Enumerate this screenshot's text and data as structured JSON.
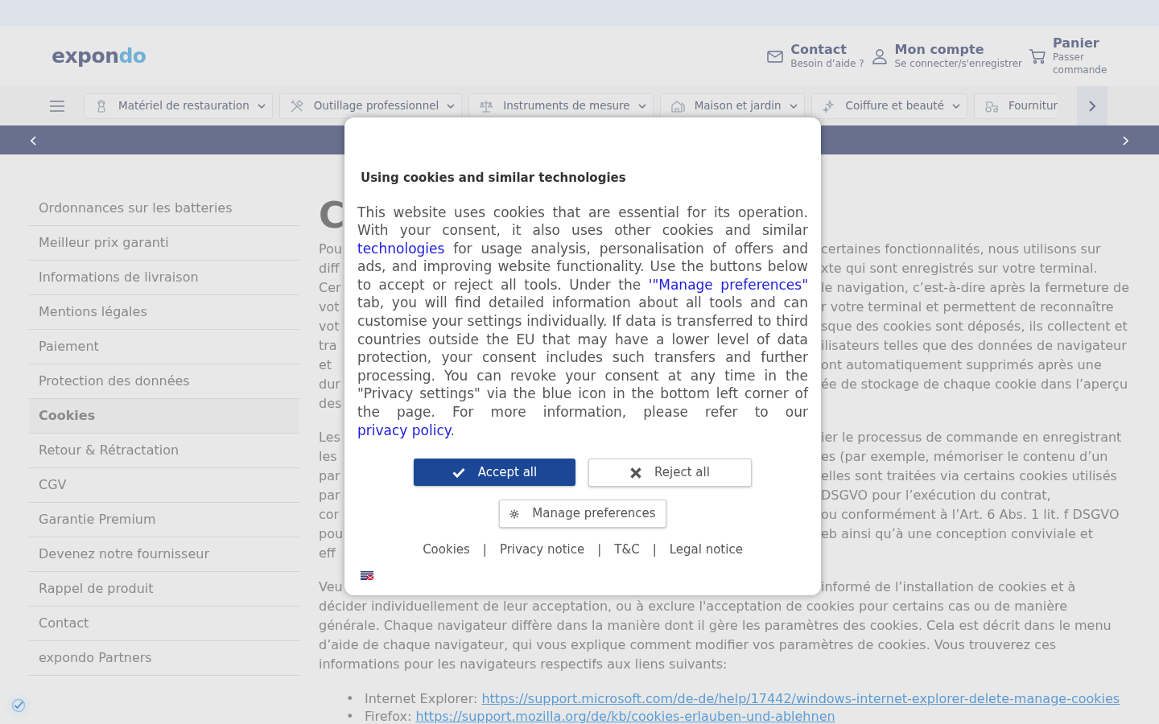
{
  "logo": {
    "main": "expon",
    "accent": "do"
  },
  "header_links": [
    {
      "kind": "mail",
      "title": "Contact",
      "subtitle": "Besoin d’aide ?"
    },
    {
      "kind": "user",
      "title": "Mon compte",
      "subtitle": "Se connecter/s'enregistrer"
    },
    {
      "kind": "cart",
      "title": "Panier",
      "subtitle": "Passer commande"
    }
  ],
  "categories": [
    {
      "kind": "chef",
      "label": "Matériel de restauration"
    },
    {
      "kind": "tools",
      "label": "Outillage professionnel"
    },
    {
      "kind": "scale",
      "label": "Instruments de mesure"
    },
    {
      "kind": "house",
      "label": "Maison et jardin"
    },
    {
      "kind": "sparkle",
      "label": "Coiffure et beauté"
    },
    {
      "kind": "tractor",
      "label": "Fournitur"
    }
  ],
  "sidebar": {
    "items": [
      {
        "label": "Ordonnances sur les batteries",
        "selected": false
      },
      {
        "label": "Meilleur prix garanti",
        "selected": false
      },
      {
        "label": "Informations de livraison",
        "selected": false
      },
      {
        "label": "Mentions légales",
        "selected": false
      },
      {
        "label": "Paiement",
        "selected": false
      },
      {
        "label": "Protection des données",
        "selected": false
      },
      {
        "label": "Cookies",
        "selected": true
      },
      {
        "label": "Retour & Rétractation",
        "selected": false
      },
      {
        "label": "CGV",
        "selected": false
      },
      {
        "label": "Garantie Premium",
        "selected": false
      },
      {
        "label": "Devenez notre fournisseur",
        "selected": false
      },
      {
        "label": "Rappel de produit",
        "selected": false
      },
      {
        "label": "Contact",
        "selected": false
      },
      {
        "label": "expondo Partners",
        "selected": false
      }
    ]
  },
  "content": {
    "heading": "C",
    "paragraphs": [
      [
        {
          "left": "Pou",
          "right": "certaines fonctionnalités, nous utilisons sur"
        },
        {
          "left": "diff",
          "right": "xte qui sont enregistrés sur votre terminal."
        },
        {
          "left": "Cer",
          "right": "le navigation, c’est-à-dire après la fermeture de"
        },
        {
          "left": "vot",
          "right": "r votre terminal et permettent de reconnaître"
        },
        {
          "left": "vot",
          "right": "sque des cookies sont déposés, ils collectent et"
        },
        {
          "left": "tra",
          "right": "ilisateurs telles que des données de navigateur"
        },
        {
          "left": "et",
          "right": "ont automatiquement supprimés après une"
        },
        {
          "left": "dur",
          "right": "ée de stockage de chaque cookie dans l’aperçu"
        },
        {
          "left": "des"
        }
      ],
      [
        {
          "left": "Les",
          "right": "ier le processus de commande en enregistrant"
        },
        {
          "left": "les",
          "right": "es (par exemple, mémoriser le contenu d’un"
        },
        {
          "left": "par",
          "right": "elles sont traitées via certains cookies utilisés"
        },
        {
          "left": "par",
          "right": "DSGVO pour l’exécution du contrat,"
        },
        {
          "left": "cor",
          "right": "ou conformément à l’Art. 6 Abs. 1 lit. f DSGVO"
        },
        {
          "left": "pou",
          "right": "eb ainsi qu’à une conception conviviale et"
        },
        {
          "left": "eff"
        }
      ],
      [
        {
          "left": "Veu",
          "right": "informé de l’installation de cookies et à"
        },
        {
          "full": "décider individuellement de leur acceptation, ou à exclure l'acceptation de cookies pour certains cas ou de manière"
        },
        {
          "full": "générale. Chaque navigateur diffère dans la manière dont il gère les paramètres des cookies. Cela est décrit dans le menu"
        },
        {
          "full": "d’aide de chaque navigateur, qui vous explique comment modifier vos paramètres de cookies. Vous trouverez ces"
        },
        {
          "full": "informations pour les navigateurs respectifs aux liens suivants:"
        }
      ]
    ],
    "bullets": [
      {
        "marker": "•",
        "label": "Internet Explorer:",
        "link": "https://support.microsoft.com/de-de/help/17442/windows-internet-explorer-delete-manage-cookies"
      },
      {
        "marker": "•",
        "label": "Firefox:",
        "link": "https://support.mozilla.org/de/kb/cookies-erlauben-und-ablehnen"
      }
    ]
  },
  "cookie_dialog": {
    "title": "Using cookies and similar technologies",
    "body": [
      {
        "text": "This website uses cookies that are essential for its operation. With your consent, it also uses other cookies and similar "
      },
      {
        "link": "technologies"
      },
      {
        "text": " for usage analysis, personalisation of offers and ads, and improving website functionality. Use the buttons below to accept or reject all tools. Under the "
      },
      {
        "link": "'\"Manage preferences\""
      },
      {
        "text": " tab, you will find detailed information about all tools and can customise your settings individually. If data is transferred to third countries outside the EU that may have a lower level of data protection, your consent includes such transfers and further processing. You can revoke your consent at any time in the \"Privacy settings\" via the blue icon in the bottom left corner of the page. For more information, please refer to our "
      },
      {
        "link": "privacy policy"
      },
      {
        "text": "."
      }
    ],
    "buttons": [
      {
        "kind": "accept",
        "label": "Accept all"
      },
      {
        "kind": "reject",
        "label": "Reject all"
      },
      {
        "kind": "manage",
        "label": "Manage preferences"
      }
    ],
    "footer_links": [
      "Cookies",
      "Privacy notice",
      "T&C",
      "Legal notice"
    ],
    "separator": "|"
  }
}
